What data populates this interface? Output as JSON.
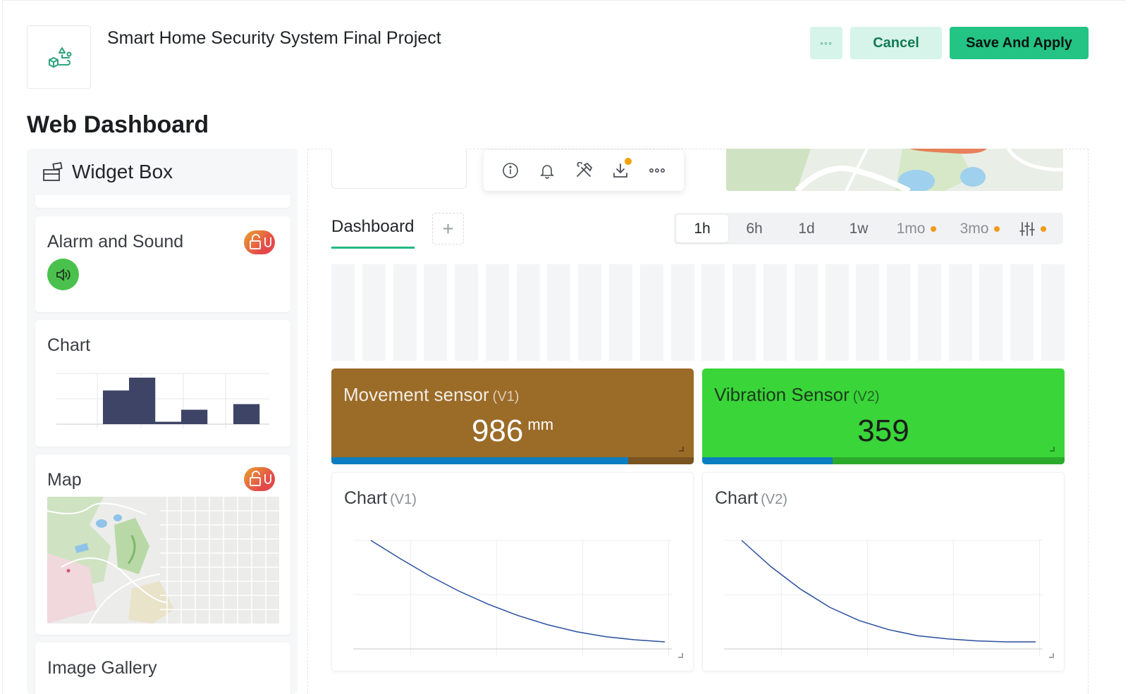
{
  "header": {
    "project_title": "Smart Home Security System Final Project",
    "more_label": "◦◦◦",
    "cancel_label": "Cancel",
    "save_label": "Save And Apply",
    "page_title": "Web Dashboard"
  },
  "widget_box": {
    "title": "Widget Box",
    "items": [
      {
        "title": "Alarm and Sound",
        "locked": true
      },
      {
        "title": "Chart",
        "locked": false
      },
      {
        "title": "Map",
        "locked": true
      },
      {
        "title": "Image Gallery",
        "locked": false
      }
    ],
    "preview_chart": {
      "type": "bar",
      "values": [
        42,
        58,
        3,
        18,
        0,
        25
      ]
    }
  },
  "toolbar": {
    "icons": [
      "info-icon",
      "bell-icon",
      "tools-icon",
      "download-icon",
      "more-icon"
    ]
  },
  "tabs": {
    "active": "Dashboard",
    "add_symbol": "+"
  },
  "time_range": {
    "options": [
      {
        "label": "1h",
        "active": true,
        "dot": false
      },
      {
        "label": "6h",
        "active": false,
        "dot": false
      },
      {
        "label": "1d",
        "active": false,
        "dot": false
      },
      {
        "label": "1w",
        "active": false,
        "dot": false
      },
      {
        "label": "1mo",
        "active": false,
        "dot": true
      },
      {
        "label": "3mo",
        "active": false,
        "dot": true
      }
    ],
    "custom_icon": "sliders-icon"
  },
  "value_widgets": [
    {
      "title": "Movement sensor",
      "pin": "(V1)",
      "value": "986",
      "unit": "mm",
      "color": "#9b6b28",
      "bar_track": "#7a5320",
      "value_color": "#ffffff",
      "progress": 0.82
    },
    {
      "title": "Vibration Sensor",
      "pin": "(V2)",
      "value": "359",
      "unit": "",
      "color": "#39d539",
      "bar_track": "#2caa2c",
      "value_color": "#1a1f1a",
      "progress": 0.36
    }
  ],
  "chart_data": [
    {
      "type": "line",
      "title": "Chart",
      "pin": "(V1)",
      "x": [
        0,
        1,
        2,
        3,
        4,
        5,
        6,
        7,
        8,
        9,
        10
      ],
      "y": [
        1.0,
        0.82,
        0.65,
        0.5,
        0.37,
        0.26,
        0.17,
        0.1,
        0.05,
        0.02,
        0.0
      ],
      "grid": true
    },
    {
      "type": "line",
      "title": "Chart",
      "pin": "(V2)",
      "x": [
        0,
        1,
        2,
        3,
        4,
        5,
        6,
        7,
        8,
        9,
        10
      ],
      "y": [
        1.0,
        0.74,
        0.52,
        0.34,
        0.21,
        0.12,
        0.06,
        0.03,
        0.01,
        0.0,
        0.0
      ],
      "grid": true
    }
  ],
  "colors": {
    "accent": "#23c484",
    "accent_soft": "#d6f4ea",
    "line": "#2a4f9e",
    "bar": "#3e4466"
  }
}
